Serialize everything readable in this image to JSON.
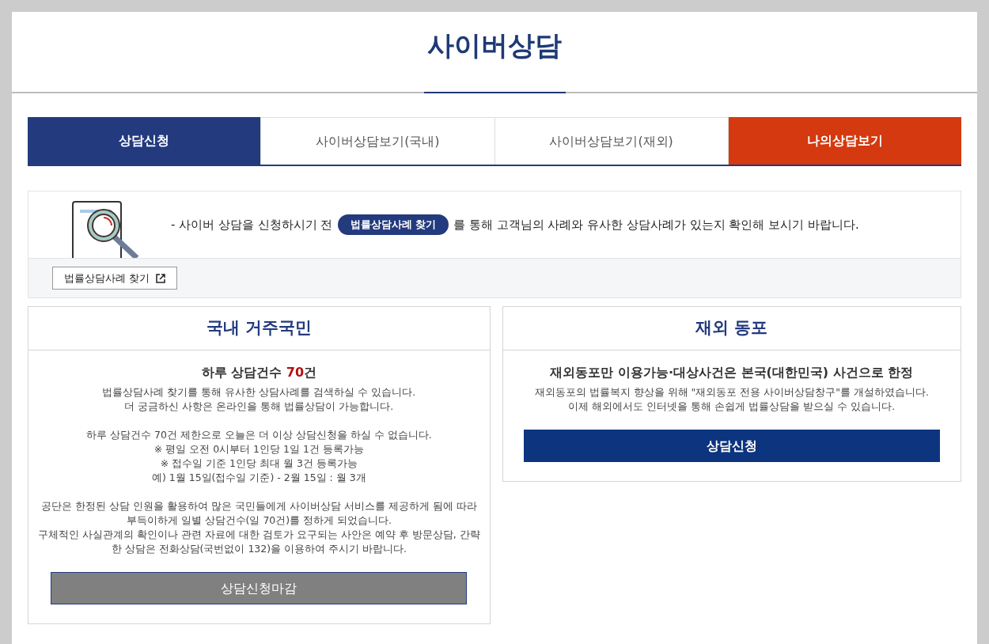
{
  "page_title": "사이버상담",
  "tabs": [
    {
      "label": "상담신청",
      "selected": true,
      "kind": "normal"
    },
    {
      "label": "사이버상담보기(국내)",
      "selected": false,
      "kind": "normal"
    },
    {
      "label": "사이버상담보기(재외)",
      "selected": false,
      "kind": "normal"
    },
    {
      "label": "나의상담보기",
      "selected": false,
      "kind": "accent"
    }
  ],
  "notice": {
    "text_before": "- 사이버 상담을 신청하시기 전",
    "badge": "법률상담사례 찾기",
    "text_after": "를 통해 고객님의 사례와 유사한 상담사례가 있는지 확인해 보시기 바랍니다.",
    "link_button": "법률상담사례 찾기"
  },
  "cards": [
    {
      "title": "국내 거주국민",
      "headline": {
        "before": "하루 상담건수 ",
        "highlight": "70",
        "after": "건"
      },
      "paragraphs": [
        [
          "법률상담사례 찾기를 통해 유사한 상담사례를 검색하실 수 있습니다.",
          "더 궁금하신 사항은 온라인을 통해 법률상담이 가능합니다."
        ],
        [
          "하루 상담건수 70건 제한으로 오늘은 더 이상 상담신청을 하실 수 없습니다.",
          "※ 평일 오전 0시부터 1인당 1일 1건 등록가능",
          "※ 접수일 기준 1인당 최대 월 3건 등록가능",
          "예) 1월 15일(접수일 기준) - 2월 15일 : 월 3개"
        ],
        [
          "공단은 한정된 상담 인원을 활용하여 많은 국민들에게 사이버상담 서비스를 제공하게 됨에 따라",
          "부득이하게 일별 상담건수(일 70건)를 정하게 되었습니다.",
          "구체적인 사실관계의 확인이나 관련 자료에 대한 검토가 요구되는 사안은 예약 후 방문상담, 간략",
          "한 상담은 전화상담(국번없이 132)을 이용하여 주시기 바랍니다."
        ]
      ],
      "button": {
        "label": "상담신청마감",
        "disabled": true
      }
    },
    {
      "title": "재외 동포",
      "headline": {
        "before": "재외동포만 이용가능·대상사건은 본국(대한민국) 사건으로 한정"
      },
      "paragraphs": [
        [
          "재외동포의 법률복지 향상을 위해 \"재외동포 전용 사이버상담창구\"를 개설하였습니다.",
          "이제 해외에서도 인터넷을 통해 손쉽게 법률상담을 받으실 수 있습니다."
        ]
      ],
      "button": {
        "label": "상담신청",
        "disabled": false
      }
    }
  ]
}
